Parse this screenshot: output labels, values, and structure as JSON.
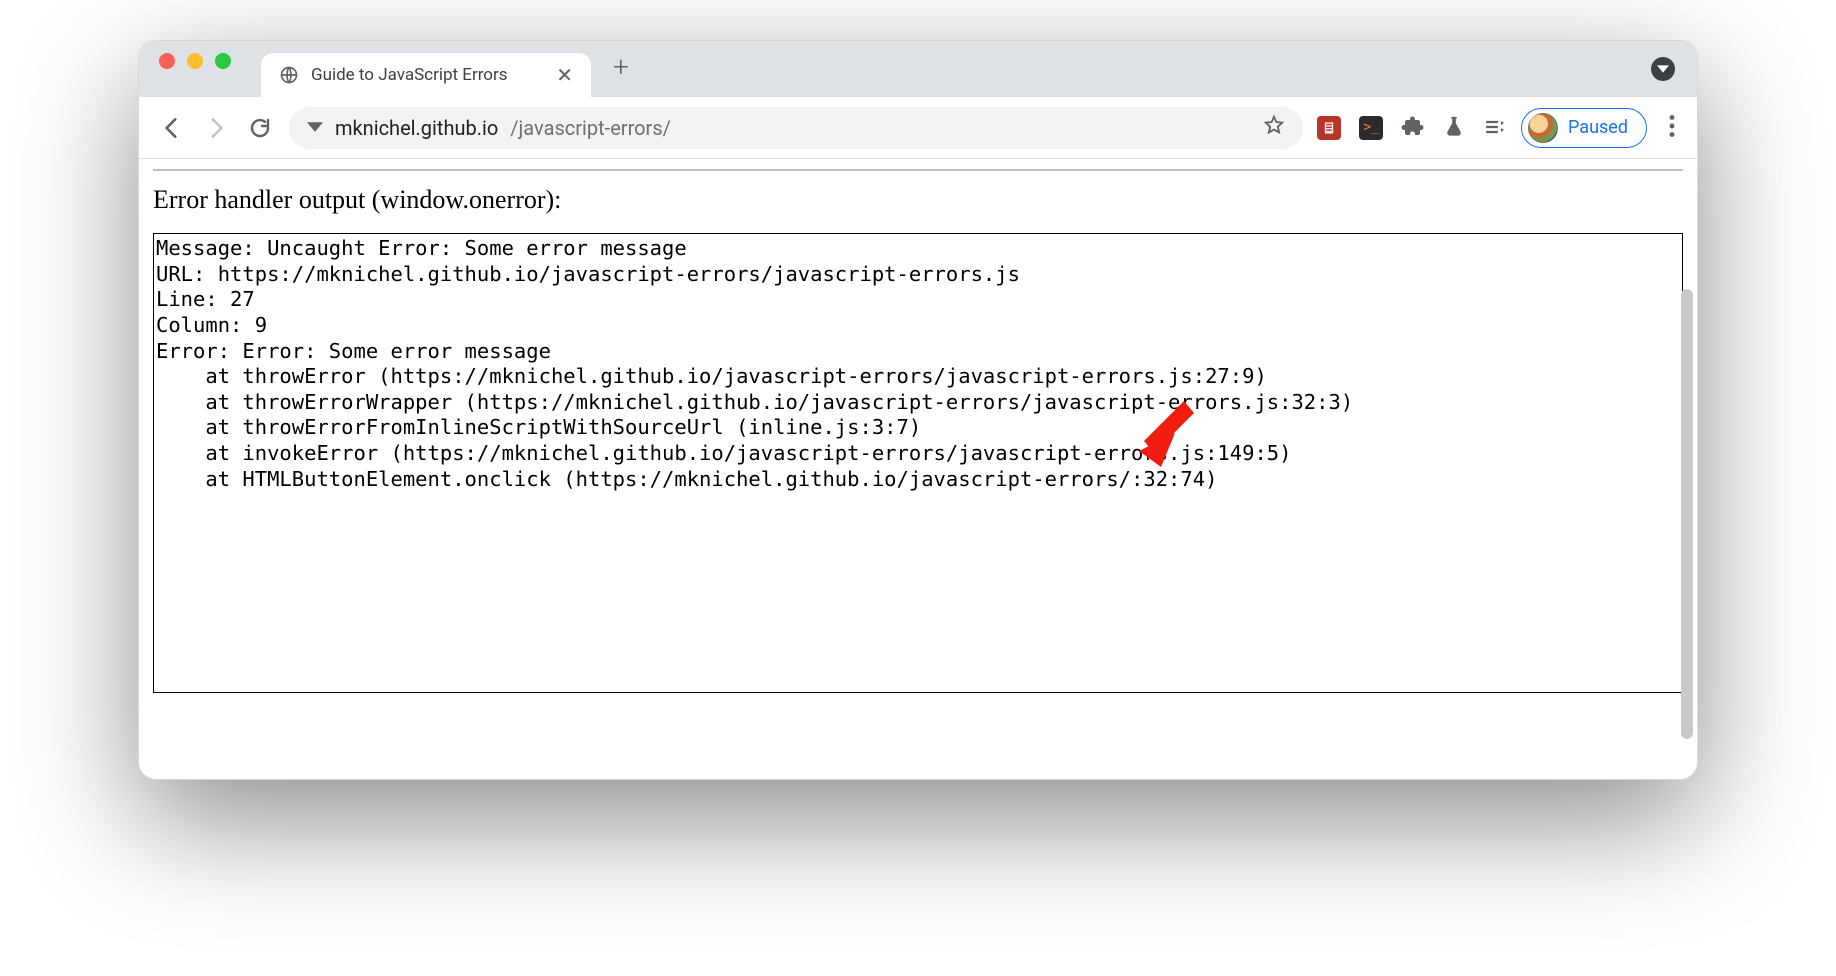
{
  "tab": {
    "title": "Guide to JavaScript Errors"
  },
  "url": {
    "host": "mknichel.github.io",
    "path": "/javascript-errors/"
  },
  "profile": {
    "status": "Paused"
  },
  "page": {
    "heading": "Error handler output (window.onerror):",
    "error_output": "Message: Uncaught Error: Some error message\nURL: https://mknichel.github.io/javascript-errors/javascript-errors.js\nLine: 27\nColumn: 9\nError: Error: Some error message\n    at throwError (https://mknichel.github.io/javascript-errors/javascript-errors.js:27:9)\n    at throwErrorWrapper (https://mknichel.github.io/javascript-errors/javascript-errors.js:32:3)\n    at throwErrorFromInlineScriptWithSourceUrl (inline.js:3:7)\n    at invokeError (https://mknichel.github.io/javascript-errors/javascript-errors.js:149:5)\n    at HTMLButtonElement.onclick (https://mknichel.github.io/javascript-errors/:32:74)"
  },
  "ext_terminal_glyph": ">_"
}
